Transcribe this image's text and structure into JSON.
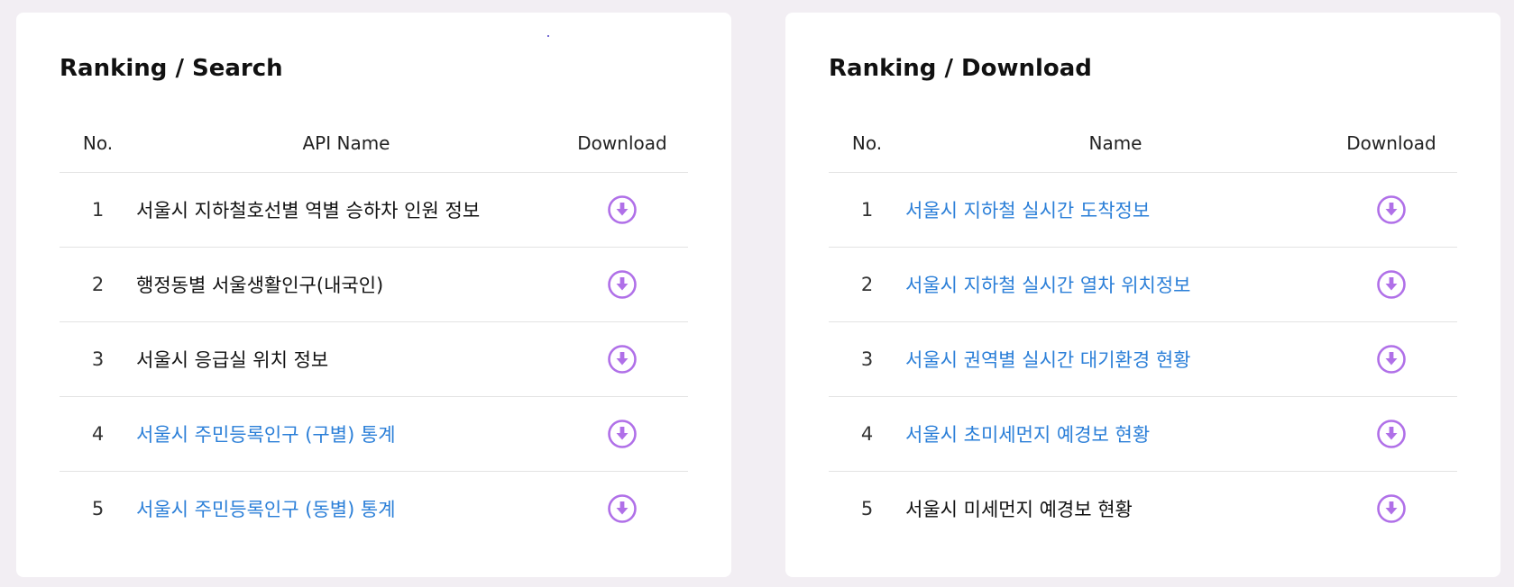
{
  "colors": {
    "page_background": "#f2eef3",
    "panel_background": "#ffffff",
    "link_text": "#2b7fd8",
    "download_icon": "#b070e8"
  },
  "search_ranking": {
    "title": "Ranking / Search",
    "columns": {
      "no": "No.",
      "name": "API Name",
      "download": "Download"
    },
    "rows": [
      {
        "no": "1",
        "name": "서울시 지하철호선별 역별 승하차 인원 정보",
        "linked": false
      },
      {
        "no": "2",
        "name": "행정동별 서울생활인구(내국인)",
        "linked": false
      },
      {
        "no": "3",
        "name": "서울시 응급실 위치 정보",
        "linked": false
      },
      {
        "no": "4",
        "name": "서울시 주민등록인구 (구별) 통계",
        "linked": true
      },
      {
        "no": "5",
        "name": "서울시 주민등록인구 (동별) 통계",
        "linked": true
      }
    ]
  },
  "download_ranking": {
    "title": "Ranking / Download",
    "columns": {
      "no": "No.",
      "name": "Name",
      "download": "Download"
    },
    "rows": [
      {
        "no": "1",
        "name": "서울시 지하철 실시간 도착정보",
        "linked": true
      },
      {
        "no": "2",
        "name": "서울시 지하철 실시간 열차 위치정보",
        "linked": true
      },
      {
        "no": "3",
        "name": "서울시 권역별 실시간 대기환경 현황",
        "linked": true
      },
      {
        "no": "4",
        "name": "서울시 초미세먼지 예경보 현황",
        "linked": true
      },
      {
        "no": "5",
        "name": "서울시 미세먼지 예경보 현황",
        "linked": false
      }
    ]
  },
  "icons": {
    "download": "download-circle-icon"
  }
}
